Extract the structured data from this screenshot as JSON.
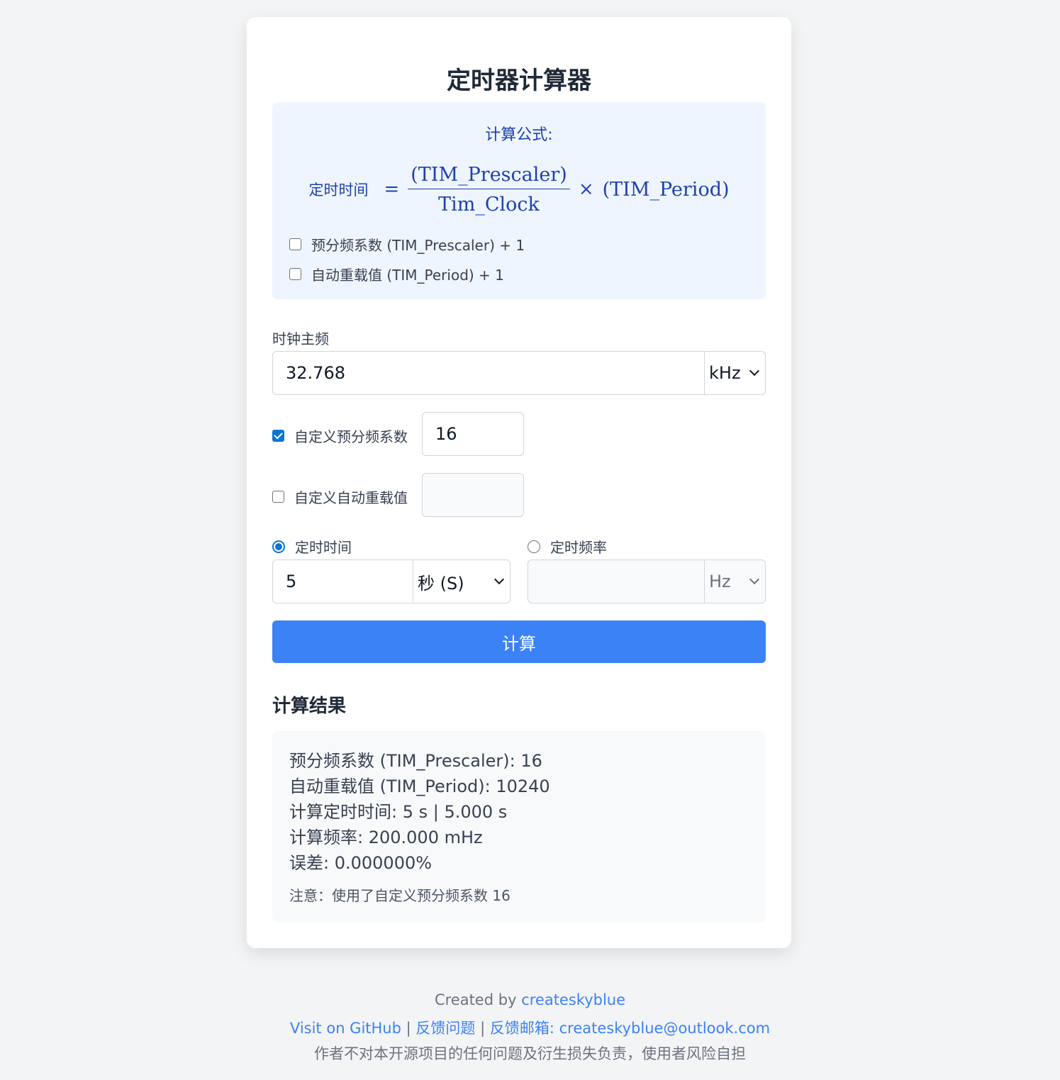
{
  "page_title": "定时器计算器",
  "formula": {
    "heading": "计算公式:",
    "lhs": "定时时间",
    "equals": "=",
    "numerator": "(TIM_Prescaler)",
    "denominator": "Tim_Clock",
    "times": "×",
    "rhs": "(TIM_Period)",
    "options": [
      {
        "label": "预分频系数 (TIM_Prescaler) + 1",
        "checked": false
      },
      {
        "label": "自动重载值 (TIM_Period) + 1",
        "checked": false
      }
    ]
  },
  "clock": {
    "label": "时钟主频",
    "value": "32.768",
    "unit": "kHz"
  },
  "custom_prescaler": {
    "label": "自定义预分频系数",
    "checked": true,
    "value": "16"
  },
  "custom_period": {
    "label": "自定义自动重载值",
    "checked": false,
    "value": ""
  },
  "mode": {
    "time": {
      "label": "定时时间",
      "selected": true,
      "value": "5",
      "unit": "秒 (S)"
    },
    "freq": {
      "label": "定时频率",
      "selected": false,
      "value": "",
      "unit": "Hz"
    }
  },
  "calculate_button": "计算",
  "result": {
    "heading": "计算结果",
    "lines": [
      "预分频系数 (TIM_Prescaler): 16",
      "自动重载值 (TIM_Period): 10240",
      "计算定时时间: 5 s | 5.000 s",
      "计算频率: 200.000 mHz",
      "误差: 0.000000%"
    ],
    "note": "注意：使用了自定义预分频系数 16"
  },
  "footer": {
    "created_by": "Created by",
    "author": "createskyblue",
    "github": "Visit on GitHub",
    "sep": "|",
    "feedback": "反馈问题",
    "email_label": "反馈邮箱: createskyblue@outlook.com",
    "disclaimer": "作者不对本开源项目的任何问题及衍生损失负责，使用者风险自担"
  },
  "colors": {
    "accent": "#3b82f6",
    "formula_text": "#1e40af",
    "formula_bg": "#eef5ff",
    "checkbox": "#0b74d6"
  }
}
